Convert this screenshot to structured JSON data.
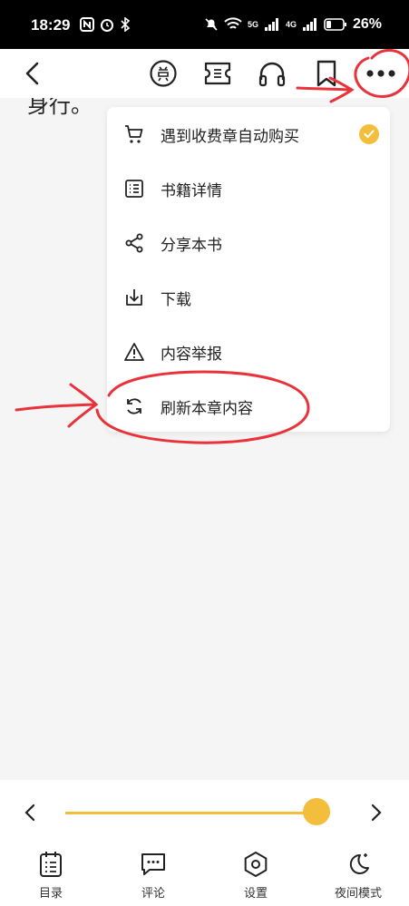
{
  "status_bar": {
    "time": "18:29",
    "battery": "26%",
    "network_labels": [
      "5G",
      "4G"
    ]
  },
  "reader": {
    "visible_text": "身行。"
  },
  "menu": {
    "items": [
      {
        "label": "遇到收费章自动购买",
        "icon": "cart-icon",
        "checked": true
      },
      {
        "label": "书籍详情",
        "icon": "list-icon"
      },
      {
        "label": "分享本书",
        "icon": "share-icon"
      },
      {
        "label": "下载",
        "icon": "download-icon"
      },
      {
        "label": "内容举报",
        "icon": "warning-icon"
      },
      {
        "label": "刷新本章内容",
        "icon": "refresh-icon"
      }
    ]
  },
  "progress": {
    "value": 0.95
  },
  "bottom_nav": {
    "items": [
      {
        "label": "目录",
        "icon": "catalog-icon"
      },
      {
        "label": "评论",
        "icon": "comment-icon"
      },
      {
        "label": "设置",
        "icon": "settings-icon"
      },
      {
        "label": "夜间模式",
        "icon": "night-mode-icon"
      }
    ]
  },
  "colors": {
    "accent": "#f2be3c",
    "annotation": "#e8333a"
  }
}
